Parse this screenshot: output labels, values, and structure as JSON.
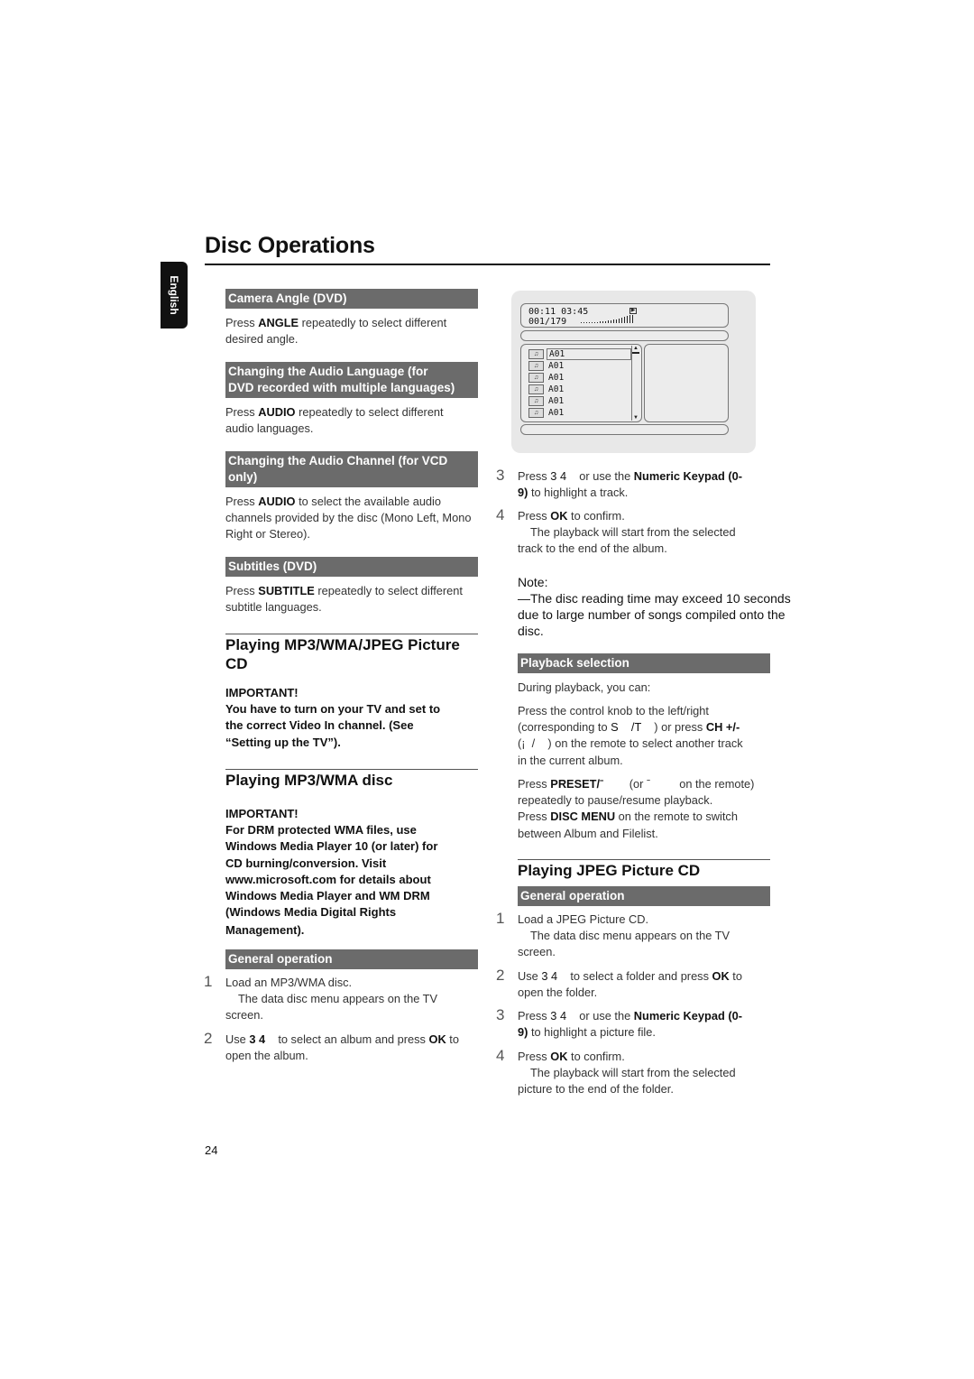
{
  "page": {
    "title": "Disc Operations",
    "language_tab": "English",
    "page_number": "24"
  },
  "left": {
    "camera_angle": {
      "header": "Camera Angle (DVD)",
      "l1_pre": "Press ",
      "l1_bold": "ANGLE",
      "l1_post": " repeatedly to select different",
      "l2": "desired angle."
    },
    "audio_language": {
      "header_l1": "Changing the Audio Language (for",
      "header_l2": "DVD recorded with multiple languages)",
      "l1_pre": "Press ",
      "l1_bold": "AUDIO",
      "l1_post": " repeatedly to select different",
      "l2": "audio languages."
    },
    "audio_channel": {
      "header_l1": "Changing the Audio Channel  (for VCD",
      "header_l2": "only)",
      "l1_pre": "Press ",
      "l1_bold": "AUDIO",
      "l1_post": " to select the available audio",
      "l2": "channels provided by the disc (Mono Left, Mono",
      "l3": "Right or Stereo)."
    },
    "subtitles": {
      "header": "Subtitles (DVD)",
      "l1_pre": "Press ",
      "l1_bold": "SUBTITLE",
      "l1_post": " repeatedly to select different",
      "l2": "subtitle languages."
    },
    "mp3_jpeg": {
      "heading_l1": "Playing MP3/WMA/JPEG Picture",
      "heading_l2": "CD",
      "important": "IMPORTANT!",
      "lines": [
        "You have to turn on your TV and set to",
        "the correct Video In channel. (See",
        "“Setting up the TV”)."
      ]
    },
    "mp3_wma": {
      "heading": "Playing MP3/WMA disc",
      "important": "IMPORTANT!",
      "lines": [
        "For DRM protected WMA files, use",
        "Windows Media Player 10 (or later) for",
        "CD burning/conversion. Visit",
        "www.microsoft.com for details about",
        "Windows Media Player and WM DRM",
        "(Windows Media Digital Rights",
        "Management)."
      ]
    },
    "general_operation": {
      "header": "General operation",
      "steps": [
        {
          "n": "1",
          "l1": "Load an MP3/WMA disc.",
          "l2": "    The data disc menu appears on the TV",
          "l3": "screen."
        },
        {
          "n": "2",
          "l1_pre": "Use ",
          "l1_bold": "3 4",
          "l1_mid": "    to select an album and press ",
          "l1_bold2": "OK",
          "l1_post": " to",
          "l2": "open the album."
        }
      ]
    }
  },
  "osd": {
    "elapsed": "00:11",
    "total": "03:45",
    "track_counter": "001/179",
    "play_state_icon": "play-icon",
    "tracks": [
      "A01",
      "A01",
      "A01",
      "A01",
      "A01",
      "A01"
    ],
    "track_icon_label": "mp3"
  },
  "right": {
    "steps": [
      {
        "n": "3",
        "l1_pre": "Press ",
        "l1_key": "3 4",
        "l1_mid": "    or use the ",
        "l1_bold": "Numeric Keypad (0-",
        "l2_bold": "9)",
        "l2_post": " to highlight a track."
      },
      {
        "n": "4",
        "l1_pre": "Press ",
        "l1_bold": "OK",
        "l1_post": " to confirm.",
        "l2": "    The playback will start from the selected",
        "l3": "track to the end of the album."
      }
    ],
    "note": {
      "label": "Note:",
      "lines": [
        "—The disc reading time may exceed 10 seconds",
        "due to large number of songs compiled onto the",
        "disc."
      ]
    },
    "playback_selection": {
      "header": "Playback selection",
      "intro": "During playback, you can:",
      "p1_l1": "Press the control knob to the left/right",
      "p1_l2_pre": "(corresponding to ",
      "p1_l2_key": "S    /T",
      "p1_l2_mid": "    ) or press ",
      "p1_l2_bold": "CH +/-",
      "p1_l3": "(¡  /    ) on the remote to select another track",
      "p1_l4": "in the current album.",
      "p2_l1_pre": "Press ",
      "p2_l1_bold": "PRESET/ˉ",
      "p2_l1_post": "        (or ˉ         on the remote)",
      "p2_l2": "repeatedly to pause/resume playback.",
      "p3_l1_pre": "Press ",
      "p3_l1_bold": "DISC MENU",
      "p3_l1_post": " on the remote to switch",
      "p3_l2": "between Album and Filelist."
    },
    "jpeg": {
      "heading": "Playing JPEG Picture CD",
      "header": "General operation",
      "steps": [
        {
          "n": "1",
          "l1": "Load a JPEG Picture CD.",
          "l2": "    The data disc menu appears on the TV",
          "l3": "screen."
        },
        {
          "n": "2",
          "l1_pre": "Use ",
          "l1_key": "3 4",
          "l1_mid": "    to select a folder and press ",
          "l1_bold": "OK",
          "l1_post": " to",
          "l2": "open the folder."
        },
        {
          "n": "3",
          "l1_pre": "Press ",
          "l1_key": "3 4",
          "l1_mid": "    or use the ",
          "l1_bold": "Numeric Keypad (0-",
          "l2_bold": "9)",
          "l2_post": " to highlight a picture file."
        },
        {
          "n": "4",
          "l1_pre": "Press ",
          "l1_bold": "OK",
          "l1_post": " to confirm.",
          "l2": "    The playback will start from the selected",
          "l3": "picture to the end of the folder."
        }
      ]
    }
  }
}
